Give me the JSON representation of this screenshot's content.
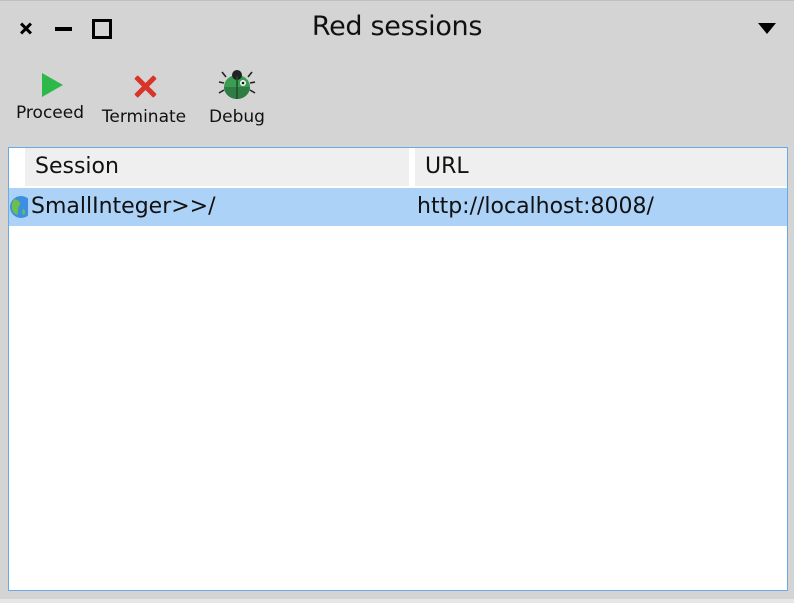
{
  "window": {
    "title": "Red sessions",
    "controls": [
      "close-icon",
      "minimize-icon",
      "maximize-icon",
      "menu-triangle-icon"
    ]
  },
  "toolbar": {
    "proceed_label": "Proceed",
    "terminate_label": "Terminate",
    "debug_label": "Debug",
    "icons": {
      "proceed": "play-icon",
      "terminate": "x-icon",
      "debug": "bug-icon"
    },
    "colors": {
      "proceed": "#2db84a",
      "terminate": "#d8342a",
      "debug": "#3a9d54"
    }
  },
  "table": {
    "columns": [
      "Session",
      "URL"
    ],
    "rows": [
      {
        "session": "SmallInteger>>/",
        "url": "http://localhost:8008/",
        "selected": true,
        "icon": "globe-icon"
      }
    ],
    "selection_color": "#acd2f7"
  }
}
